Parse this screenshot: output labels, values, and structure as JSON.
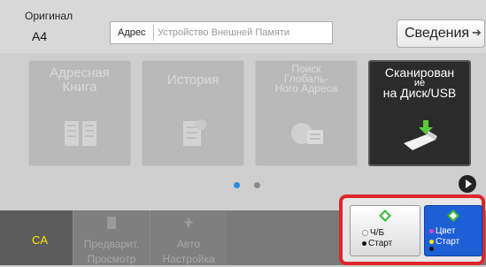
{
  "header": {
    "original_label": "Оригинал",
    "original_value": "A4",
    "address_label": "Адрес",
    "address_placeholder": "Устройство Внешней Памяти",
    "details_label": "Сведения"
  },
  "tiles": [
    {
      "line1": "Адресная",
      "line2": "Книга",
      "line3": "",
      "state": "disabled",
      "icon": "address-book-icon"
    },
    {
      "line1": "История",
      "line2": "",
      "line3": "",
      "state": "disabled",
      "icon": "history-icon"
    },
    {
      "line1": "Поиск",
      "line2": "Глобаль-",
      "line3": "Ного Адреса",
      "state": "disabled",
      "icon": "global-address-icon"
    },
    {
      "line1": "Сканирован",
      "line2": "ие",
      "line3": "на Диск/USB",
      "state": "active",
      "icon": "usb-drive-icon"
    }
  ],
  "pager": {
    "pages": 2,
    "current": 1
  },
  "bottom": {
    "ca_label": "CA",
    "preview_label_1": "Предварит.",
    "preview_label_2": "Просмотр",
    "auto_label_1": "Авто",
    "auto_label_2": "Настройка",
    "bw_start_line1": "Ч/Б",
    "bw_start_line2": "Старт",
    "color_start_line1": "Цвет",
    "color_start_line2": "Старт"
  },
  "colors": {
    "start_highlight": "#e0252b",
    "color_start_bg": "#1e5fd6",
    "ca_text": "#ffe400",
    "start_diamond": "#3bbf3b",
    "pager_active": "#2a8ee6"
  }
}
